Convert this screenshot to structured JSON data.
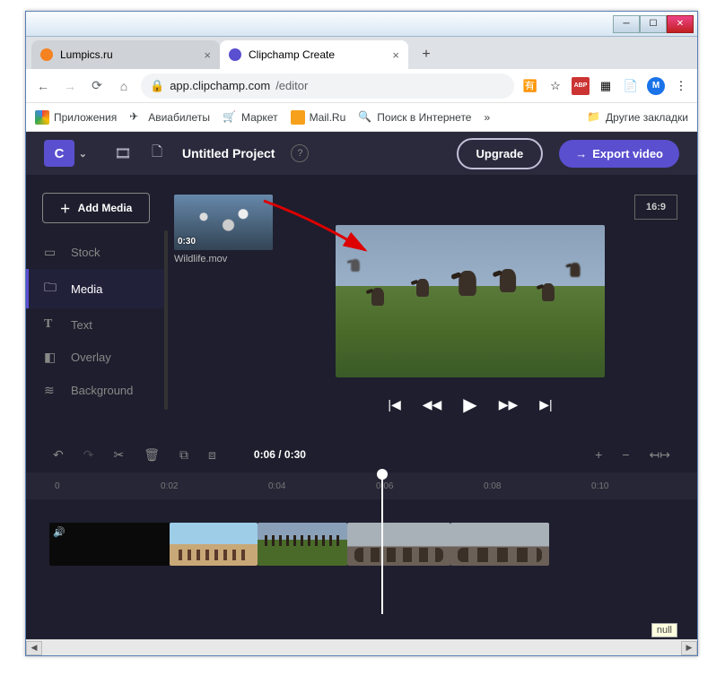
{
  "window": {
    "title": "Clipchamp Create"
  },
  "tabs": [
    {
      "favcolor": "#f58220",
      "title": "Lumpics.ru",
      "active": false
    },
    {
      "favcolor": "#5a4fcf",
      "title": "Clipchamp Create",
      "active": true
    }
  ],
  "addressbar": {
    "lock": "🔒",
    "domain": "app.clipchamp.com",
    "path": "/editor"
  },
  "ext_icons": [
    "🌐",
    "☆",
    "ABP",
    "⬚",
    "📄",
    "M",
    "⋮"
  ],
  "bookmarks": {
    "apps": "Приложения",
    "items": [
      "Авиабилеты",
      "Маркет",
      "Mail.Ru",
      "Поиск в Интернете"
    ],
    "more": "»",
    "other": "Другие закладки"
  },
  "topbar": {
    "logo": "C",
    "project_title": "Untitled Project",
    "upgrade": "Upgrade",
    "export": "Export video"
  },
  "sidebar": {
    "add_media": "Add Media",
    "items": [
      {
        "icon": "▣",
        "label": "Stock",
        "active": false
      },
      {
        "icon": "🗀",
        "label": "Media",
        "active": true
      },
      {
        "icon": "T",
        "label": "Text",
        "active": false
      },
      {
        "icon": "◧",
        "label": "Overlay",
        "active": false
      },
      {
        "icon": "≋",
        "label": "Background",
        "active": false
      }
    ]
  },
  "media": {
    "duration": "0:30",
    "filename": "Wildlife.mov"
  },
  "canvas": {
    "aspect": "16:9"
  },
  "playback": {
    "prev": "|◀",
    "rw": "◀◀",
    "play": "▶",
    "ff": "▶▶",
    "next": "▶|"
  },
  "tools": {
    "undo": "↶",
    "redo": "↷",
    "cut": "✂",
    "delete": "🗑",
    "copy": "⧉",
    "paste": "⧈",
    "time": "0:06 / 0:30",
    "zoom_in": "+",
    "zoom_out": "−",
    "fit": "↤↦"
  },
  "ruler": [
    "0",
    "0:02",
    "0:04",
    "0:06",
    "0:08",
    "0:10"
  ],
  "null_label": "null"
}
